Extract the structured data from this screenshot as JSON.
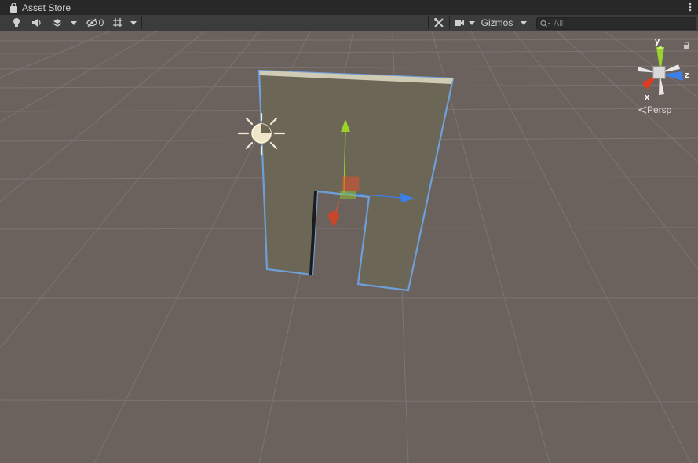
{
  "window": {
    "title": "Asset Store"
  },
  "toolbar": {
    "hidden_count": "0",
    "gizmos_label": "Gizmos",
    "search_placeholder": "All"
  },
  "orientation_gizmo": {
    "axis_y": "y",
    "axis_z": "z",
    "axis_x": "x",
    "projection_label": "Persp"
  },
  "colors": {
    "grid_background": "#6b625e",
    "toolbar": "#3c3c3c",
    "titlebar": "#282828",
    "selection_outline": "#6f9fd8",
    "axis_x": "#e0512f",
    "axis_y": "#9bd32a",
    "axis_z": "#3d7fe8"
  },
  "icons": [
    "lock-icon",
    "lightbulb-icon",
    "audio-icon",
    "effects-icon",
    "hidden-objects-icon",
    "grid-icon",
    "tools-icon",
    "camera-icon",
    "search-icon",
    "sun-light-icon"
  ]
}
